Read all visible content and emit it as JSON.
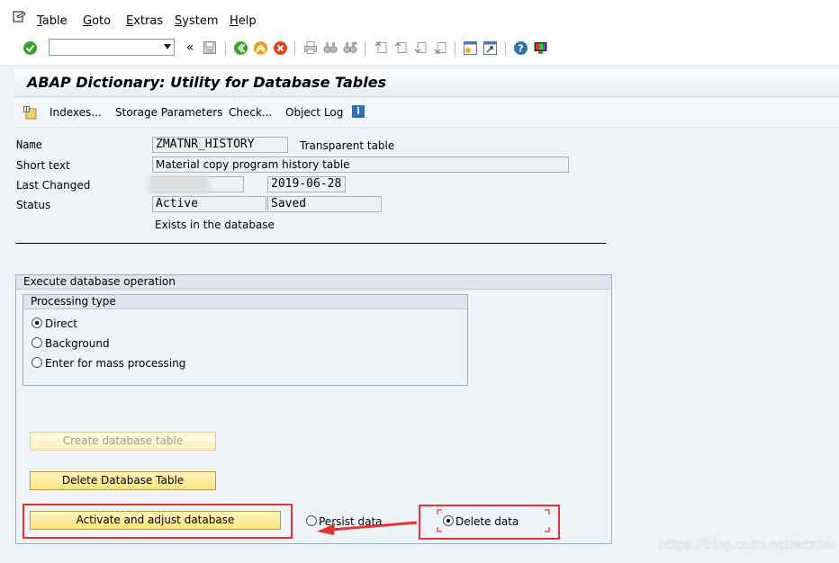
{
  "menu": {
    "items": [
      {
        "label": "Table",
        "accel": "T",
        "rest": "able"
      },
      {
        "label": "Goto",
        "accel": "G",
        "rest": "oto"
      },
      {
        "label": "Extras",
        "accel": "E",
        "rest": "xtras"
      },
      {
        "label": "System",
        "accel": "S",
        "rest": "ystem"
      },
      {
        "label": "Help",
        "accel": "H",
        "rest": "elp"
      }
    ]
  },
  "toolbar": {
    "command_value": "",
    "colors": {
      "enter": "#3aa12f",
      "back": "#3aa12f",
      "exit": "#e9a21a",
      "cancel": "#d9461f",
      "help": "#2f6fb7"
    }
  },
  "title": "ABAP Dictionary: Utility for Database Tables",
  "app_toolbar": {
    "indexes": "Indexes...",
    "storage": "Storage Parameters",
    "check": "Check...",
    "object_log": "Object Log"
  },
  "form": {
    "name_label": "Name",
    "name_value": "ZMATNR_HISTORY",
    "table_type": "Transparent table",
    "short_text_label": "Short text",
    "short_text_value": "Material copy program history table",
    "last_changed_label": "Last Changed",
    "last_changed_date": "2019-06-28",
    "status_label": "Status",
    "status_value1": "Active",
    "status_value2": "Saved",
    "exists_text": "Exists in the database"
  },
  "execute_group": {
    "title": "Execute database operation",
    "processing": {
      "title": "Processing type",
      "options": [
        {
          "label": "Direct",
          "selected": true
        },
        {
          "label": "Background",
          "selected": false
        },
        {
          "label": "Enter for mass processing",
          "selected": false
        }
      ]
    },
    "buttons": {
      "create": "Create database table",
      "delete": "Delete Database Table",
      "activate": "Activate and adjust database"
    },
    "data_options": [
      {
        "label": "Persist data",
        "selected": false
      },
      {
        "label": "Delete data",
        "selected": true
      }
    ]
  },
  "annotation": {
    "highlight_color": "#e53333"
  },
  "watermark": "https://blog.csdn.net/wtxhai"
}
